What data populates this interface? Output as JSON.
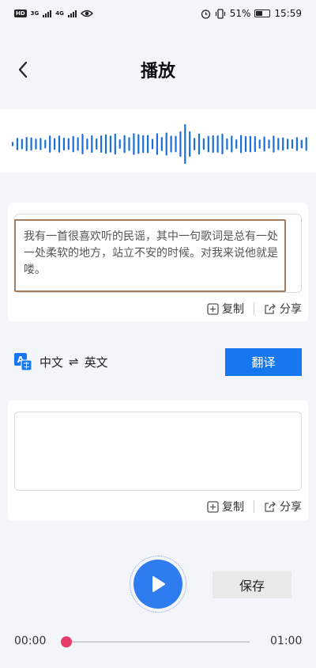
{
  "status_bar": {
    "hd": "HD",
    "net1": "3G",
    "net2": "4G",
    "battery_percent": "51%",
    "time": "15:59",
    "battery_level": 0.51
  },
  "header": {
    "title": "播放"
  },
  "source_panel": {
    "text": "我有一首很喜欢听的民谣，其中一句歌词是总有一处一处柔软的地方，站立不安的时候。对我来说他就是喽。",
    "copy_label": "复制",
    "share_label": "分享"
  },
  "language": {
    "source": "中文",
    "swap_symbol": "⇌",
    "target": "英文",
    "translate_label": "翻译"
  },
  "target_panel": {
    "text": "",
    "copy_label": "复制",
    "share_label": "分享"
  },
  "player": {
    "save_label": "保存",
    "current_time": "00:00",
    "total_time": "01:00",
    "progress": 0
  },
  "colors": {
    "accent": "#1677ee",
    "wave": "#1a6fd8",
    "thumb": "#e53c6a",
    "highlight": "#a27c5f"
  },
  "icons": [
    "back-icon",
    "copy-icon",
    "share-icon",
    "translate-language-icon",
    "play-icon",
    "eye-icon",
    "alarm-icon",
    "vibrate-icon",
    "battery-icon"
  ]
}
